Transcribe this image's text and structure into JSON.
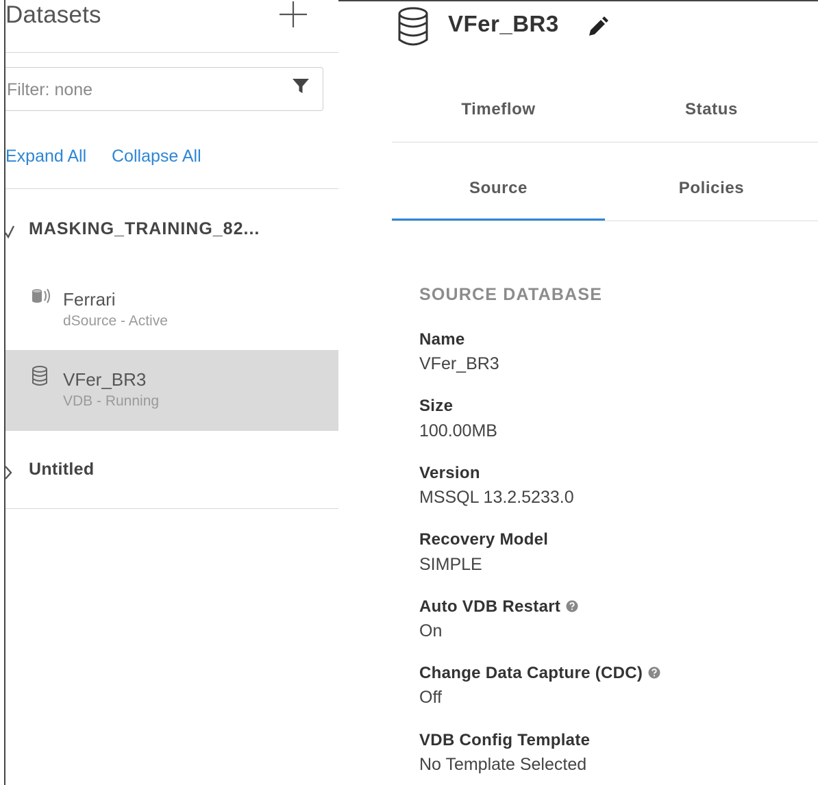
{
  "sidebar": {
    "title": "Datasets",
    "add_icon": "plus-icon",
    "filter": {
      "placeholder": "Filter: none",
      "value": "",
      "icon": "funnel-icon"
    },
    "expand_all": "Expand All",
    "collapse_all": "Collapse All",
    "groups": [
      {
        "label": "MASKING_TRAINING_82...",
        "expanded": true,
        "items": [
          {
            "name": "Ferrari",
            "status": "dSource - Active",
            "icon": "dsource-icon"
          },
          {
            "name": "VFer_BR3",
            "status": "VDB - Running",
            "icon": "database-icon",
            "selected": true
          }
        ]
      },
      {
        "label": "Untitled",
        "expanded": false,
        "items": []
      }
    ]
  },
  "main": {
    "title": "VFer_BR3",
    "title_icon": "database-icon",
    "edit_icon": "pencil-icon",
    "tabs_row1": [
      "Timeflow",
      "Status"
    ],
    "tabs_row2": [
      "Source",
      "Policies"
    ],
    "active_tab": "Source",
    "section_title": "SOURCE DATABASE",
    "fields": [
      {
        "label": "Name",
        "value": "VFer_BR3",
        "help": false
      },
      {
        "label": "Size",
        "value": "100.00MB",
        "help": false
      },
      {
        "label": "Version",
        "value": "MSSQL 13.2.5233.0",
        "help": false
      },
      {
        "label": "Recovery Model",
        "value": "SIMPLE",
        "help": false
      },
      {
        "label": "Auto VDB Restart",
        "value": "On",
        "help": true
      },
      {
        "label": "Change Data Capture (CDC)",
        "value": "Off",
        "help": true
      },
      {
        "label": "VDB Config Template",
        "value": "No Template Selected",
        "help": false
      }
    ]
  },
  "colors": {
    "accent": "#2e86d5",
    "selected_row": "#dadada",
    "divider": "#d6d6d6"
  }
}
